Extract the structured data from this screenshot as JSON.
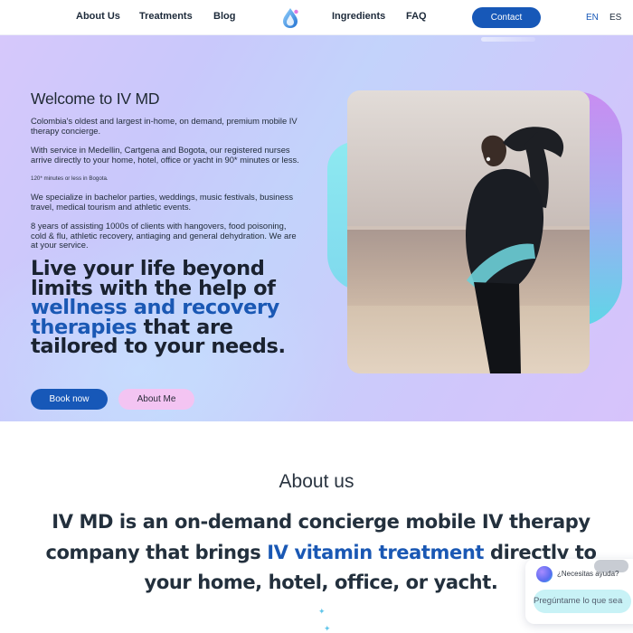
{
  "nav": {
    "links": [
      "About Us",
      "Treatments",
      "Blog",
      "Ingredients",
      "FAQ"
    ],
    "contact_label": "Contact",
    "lang_en": "EN",
    "lang_es": "ES"
  },
  "hero": {
    "title": "Welcome to IV MD",
    "paragraph_1": "Colombia's oldest and largest in-home, on demand, premium mobile IV therapy concierge.",
    "paragraph_2": "With service in Medellin, Cartgena and Bogota, our registered nurses arrive directly to your home, hotel, office or yacht in 90* minutes or less.",
    "note": "120* minutes or less in Bogota.",
    "paragraph_3": "We specialize in bachelor parties, weddings, music festivals, business travel, medical tourism and athletic events.",
    "paragraph_4": "8 years of assisting 1000s of clients with hangovers, food poisoning, cold & flu, athletic recovery, antiaging and general dehydration. We are at your service.",
    "headline_part_1": "Live your life beyond limits with the help of ",
    "headline_highlight": "wellness and recovery therapies",
    "headline_part_2": " that are tailored to your needs.",
    "book_label": "Book now",
    "about_me_label": "About Me"
  },
  "about": {
    "title": "About us",
    "text_part_1": "IV MD is an on-demand concierge mobile IV therapy company that brings ",
    "text_highlight": "IV vitamin treatment",
    "text_part_2": " directly to your home, hotel, office, or yacht."
  },
  "chat": {
    "label": "¿Necesitas ayuda?",
    "input_placeholder": "Pregúntame lo que sea"
  },
  "colors": {
    "primary": "#1758b8",
    "highlight_text": "#1a58b4",
    "about_me_button": "#f3c4f2",
    "hero_gradient": "#c9c8fb"
  }
}
